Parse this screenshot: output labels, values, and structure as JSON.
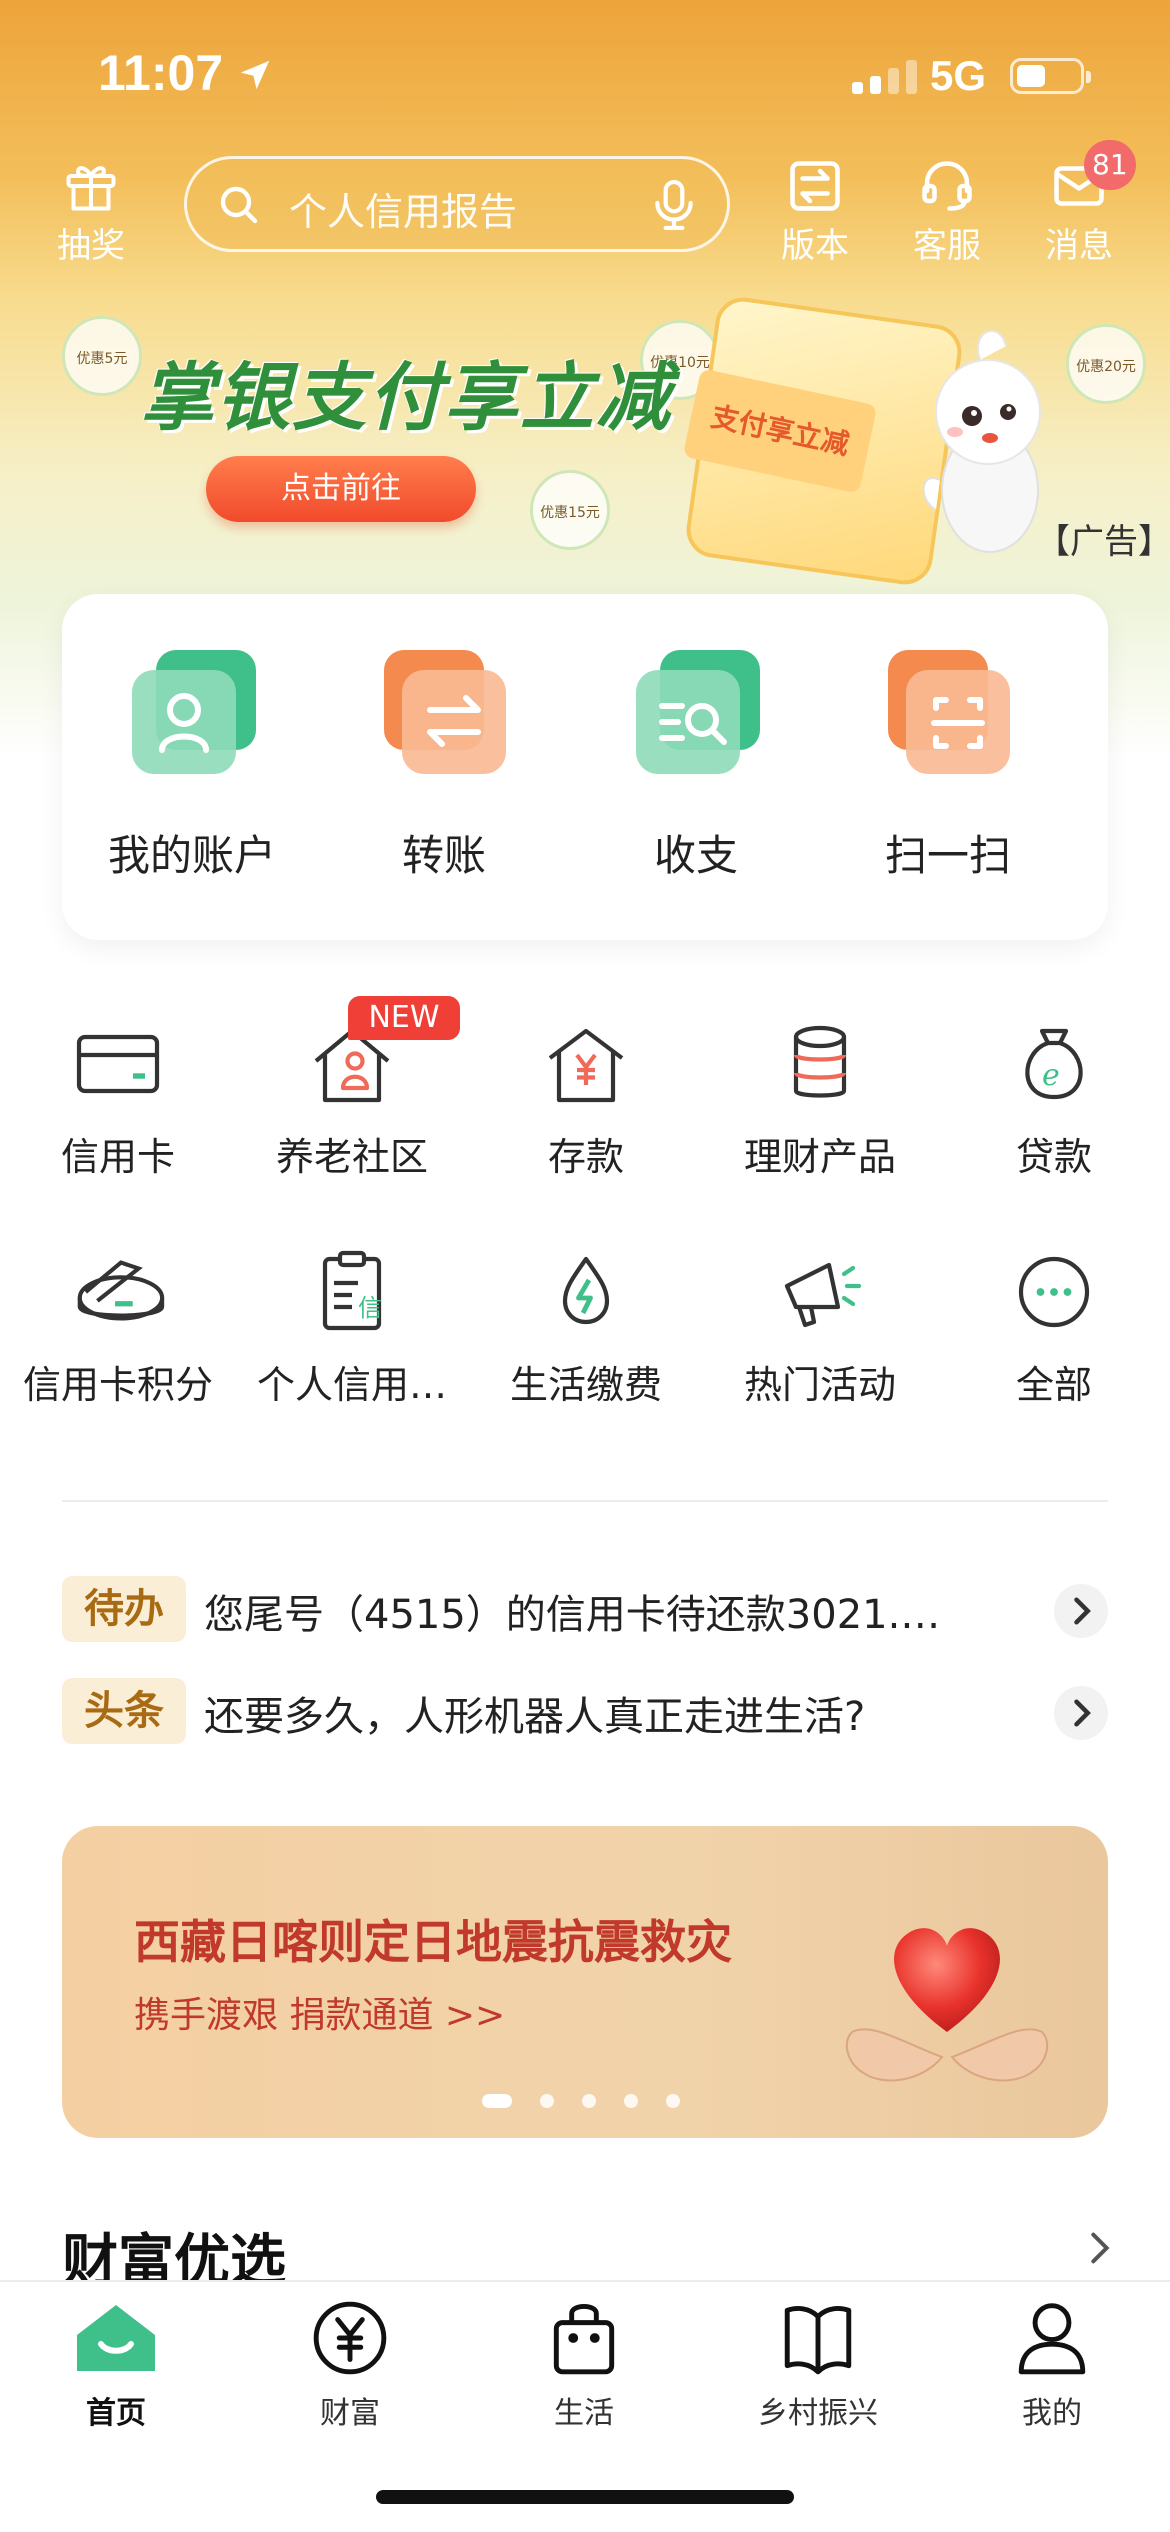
{
  "status_bar": {
    "time": "11:07",
    "network": "5G"
  },
  "header": {
    "lottery_label": "抽奖",
    "search_placeholder": "个人信用报告",
    "version_label": "版本",
    "service_label": "客服",
    "messages_label": "消息",
    "messages_badge": "81"
  },
  "promo_banner": {
    "title": "掌银支付享立减",
    "button": "点击前往",
    "ticket_text": "支付享立减",
    "ad_tag": "【广告】",
    "coupons": [
      "优惠5元",
      "优惠10元",
      "优惠15元",
      "优惠20元"
    ]
  },
  "quick_actions": [
    {
      "label": "我的账户",
      "icon": "account-icon",
      "color": "#3fc08a"
    },
    {
      "label": "转账",
      "icon": "transfer-icon",
      "color": "#f58a4e"
    },
    {
      "label": "收支",
      "icon": "income-expense-icon",
      "color": "#3fc08a"
    },
    {
      "label": "扫一扫",
      "icon": "scan-icon",
      "color": "#f58a4e"
    }
  ],
  "services": [
    {
      "label": "信用卡",
      "icon": "credit-card-icon"
    },
    {
      "label": "养老社区",
      "icon": "elderly-community-icon",
      "badge": "NEW"
    },
    {
      "label": "存款",
      "icon": "deposit-icon"
    },
    {
      "label": "理财产品",
      "icon": "wealth-product-icon"
    },
    {
      "label": "贷款",
      "icon": "loan-icon"
    },
    {
      "label": "信用卡积分",
      "icon": "card-points-icon"
    },
    {
      "label": "个人信用…",
      "icon": "credit-report-icon",
      "icon_text": "信"
    },
    {
      "label": "生活缴费",
      "icon": "bill-payment-icon"
    },
    {
      "label": "热门活动",
      "icon": "megaphone-icon"
    },
    {
      "label": "全部",
      "icon": "more-icon"
    }
  ],
  "notices": [
    {
      "tag": "待办",
      "text": "您尾号（4515）的信用卡待还款3021.…"
    },
    {
      "tag": "头条",
      "text": "还要多久，人形机器人真正走进生活?"
    }
  ],
  "charity_banner": {
    "title": "西藏日喀则定日地震抗震救灾",
    "subtitle": "携手渡艰 捐款通道 >>",
    "slides": 5,
    "active_slide": 1
  },
  "section": {
    "title": "财富优选"
  },
  "tabbar": [
    {
      "label": "首页",
      "icon": "home-icon",
      "active": true
    },
    {
      "label": "财富",
      "icon": "yuan-icon",
      "active": false
    },
    {
      "label": "生活",
      "icon": "shopping-bag-icon",
      "active": false
    },
    {
      "label": "乡村振兴",
      "icon": "book-icon",
      "active": false
    },
    {
      "label": "我的",
      "icon": "profile-icon",
      "active": false
    }
  ],
  "colors": {
    "brand_green": "#3fc08a",
    "accent_orange": "#f58a4e",
    "header_orange": "#eda43a",
    "alert_red": "#ef3f36"
  }
}
